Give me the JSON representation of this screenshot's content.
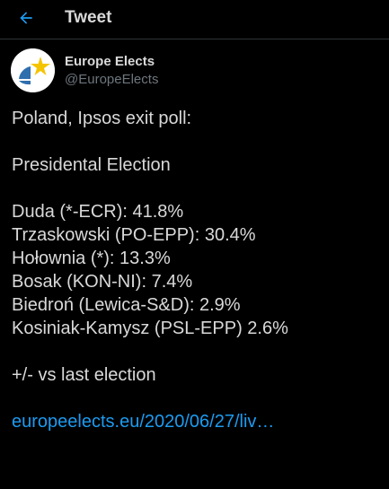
{
  "header": {
    "title": "Tweet",
    "back_icon": "arrow-left-icon",
    "accent_color": "#1d9bf0"
  },
  "author": {
    "display_name": "Europe Elects",
    "handle": "@EuropeElects",
    "avatar_icon": "europe-elects-logo"
  },
  "tweet": {
    "intro": "Poland, Ipsos exit poll:",
    "subtitle": "Presidental Election",
    "results": [
      "Duda (*-ECR): 41.8%",
      "Trzaskowski (PO-EPP): 30.4%",
      "Hołownia (*): 13.3%",
      "Bosak (KON-NI): 7.4%",
      "Biedroń (Lewica-S&D): 2.9%",
      "Kosiniak-Kamysz (PSL-EPP) 2.6%"
    ],
    "note": "+/- vs last election",
    "link_text": "europeelects.eu/2020/06/27/liv…"
  }
}
